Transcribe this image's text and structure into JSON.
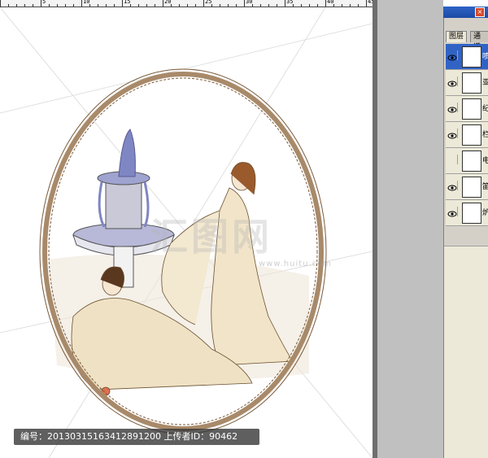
{
  "ruler": {
    "numbers": [
      "5",
      "10",
      "15",
      "20",
      "25",
      "30",
      "35",
      "40",
      "45"
    ]
  },
  "panel": {
    "tabs": [
      {
        "label": "图层",
        "active": true
      },
      {
        "label": "通道",
        "active": false
      }
    ],
    "layers": [
      {
        "name": "喷",
        "visible": true,
        "selected": true
      },
      {
        "name": "亚",
        "visible": true,
        "selected": false
      },
      {
        "name": "纪",
        "visible": true,
        "selected": false
      },
      {
        "name": "栏",
        "visible": true,
        "selected": false
      },
      {
        "name": "电",
        "visible": false,
        "selected": false
      },
      {
        "name": "笛",
        "visible": true,
        "selected": false
      },
      {
        "name": "炉",
        "visible": true,
        "selected": false
      }
    ]
  },
  "watermark": {
    "caption": "编号：20130315163412891200 上传者ID：90462",
    "logo_text": "汇图网",
    "url": "www.huitu.com"
  },
  "colors": {
    "frame": "#a88a6a",
    "dress": "#f1e4c8",
    "fountain_water": "#7f86c4",
    "selection": "#3163c5"
  }
}
